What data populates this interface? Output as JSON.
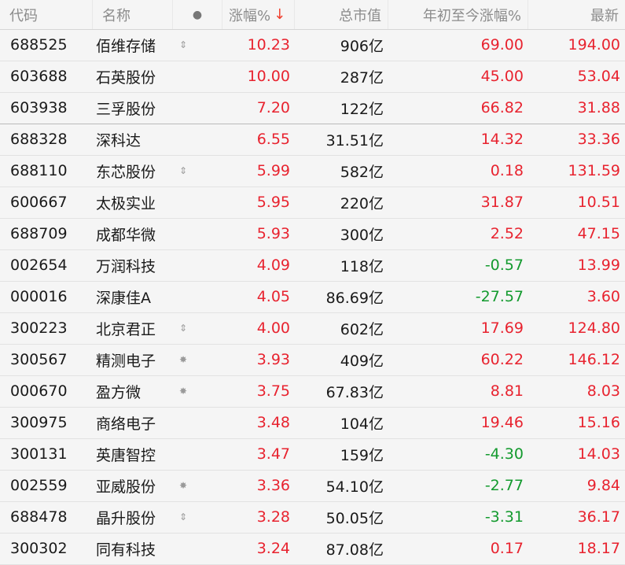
{
  "header": {
    "code": "代码",
    "name": "名称",
    "dot": "●",
    "change": "涨幅%",
    "sort_arrow": "↓",
    "market_cap": "总市值",
    "ytd": "年初至今涨幅%",
    "latest": "最新"
  },
  "colors": {
    "up": "#e8232f",
    "down": "#139a2e",
    "sort_accent": "#f0402f"
  },
  "rows": [
    {
      "code": "688525",
      "name": "佰维存储",
      "icon": "⇕",
      "icon_name": "margin-arrows-icon",
      "change": "10.23",
      "cap": "906亿",
      "ytd": "69.00",
      "ytd_dir": "up",
      "latest": "194.00"
    },
    {
      "code": "603688",
      "name": "石英股份",
      "icon": "",
      "icon_name": "",
      "change": "10.00",
      "cap": "287亿",
      "ytd": "45.00",
      "ytd_dir": "up",
      "latest": "53.04"
    },
    {
      "code": "603938",
      "name": "三孚股份",
      "icon": "",
      "icon_name": "",
      "change": "7.20",
      "cap": "122亿",
      "ytd": "66.82",
      "ytd_dir": "up",
      "latest": "31.88"
    },
    {
      "code": "688328",
      "name": "深科达",
      "icon": "",
      "icon_name": "",
      "change": "6.55",
      "cap": "31.51亿",
      "ytd": "14.32",
      "ytd_dir": "up",
      "latest": "33.36"
    },
    {
      "code": "688110",
      "name": "东芯股份",
      "icon": "⇕",
      "icon_name": "margin-arrows-icon",
      "change": "5.99",
      "cap": "582亿",
      "ytd": "0.18",
      "ytd_dir": "up",
      "latest": "131.59"
    },
    {
      "code": "600667",
      "name": "太极实业",
      "icon": "",
      "icon_name": "",
      "change": "5.95",
      "cap": "220亿",
      "ytd": "31.87",
      "ytd_dir": "up",
      "latest": "10.51"
    },
    {
      "code": "688709",
      "name": "成都华微",
      "icon": "",
      "icon_name": "",
      "change": "5.93",
      "cap": "300亿",
      "ytd": "2.52",
      "ytd_dir": "up",
      "latest": "47.15"
    },
    {
      "code": "002654",
      "name": "万润科技",
      "icon": "",
      "icon_name": "",
      "change": "4.09",
      "cap": "118亿",
      "ytd": "-0.57",
      "ytd_dir": "down",
      "latest": "13.99"
    },
    {
      "code": "000016",
      "name": "深康佳A",
      "icon": "",
      "icon_name": "",
      "change": "4.05",
      "cap": "86.69亿",
      "ytd": "-27.57",
      "ytd_dir": "down",
      "latest": "3.60"
    },
    {
      "code": "300223",
      "name": "北京君正",
      "icon": "⇕",
      "icon_name": "margin-arrows-icon",
      "change": "4.00",
      "cap": "602亿",
      "ytd": "17.69",
      "ytd_dir": "up",
      "latest": "124.80"
    },
    {
      "code": "300567",
      "name": "精测电子",
      "icon": "✸",
      "icon_name": "gear-icon",
      "change": "3.93",
      "cap": "409亿",
      "ytd": "60.22",
      "ytd_dir": "up",
      "latest": "146.12"
    },
    {
      "code": "000670",
      "name": "盈方微",
      "icon": "✸",
      "icon_name": "gear-icon",
      "change": "3.75",
      "cap": "67.83亿",
      "ytd": "8.81",
      "ytd_dir": "up",
      "latest": "8.03"
    },
    {
      "code": "300975",
      "name": "商络电子",
      "icon": "",
      "icon_name": "",
      "change": "3.48",
      "cap": "104亿",
      "ytd": "19.46",
      "ytd_dir": "up",
      "latest": "15.16"
    },
    {
      "code": "300131",
      "name": "英唐智控",
      "icon": "",
      "icon_name": "",
      "change": "3.47",
      "cap": "159亿",
      "ytd": "-4.30",
      "ytd_dir": "down",
      "latest": "14.03"
    },
    {
      "code": "002559",
      "name": "亚威股份",
      "icon": "✸",
      "icon_name": "gear-icon",
      "change": "3.36",
      "cap": "54.10亿",
      "ytd": "-2.77",
      "ytd_dir": "down",
      "latest": "9.84"
    },
    {
      "code": "688478",
      "name": "晶升股份",
      "icon": "⇕",
      "icon_name": "margin-arrows-icon",
      "change": "3.28",
      "cap": "50.05亿",
      "ytd": "-3.31",
      "ytd_dir": "down",
      "latest": "36.17"
    },
    {
      "code": "300302",
      "name": "同有科技",
      "icon": "",
      "icon_name": "",
      "change": "3.24",
      "cap": "87.08亿",
      "ytd": "0.17",
      "ytd_dir": "up",
      "latest": "18.17"
    }
  ]
}
